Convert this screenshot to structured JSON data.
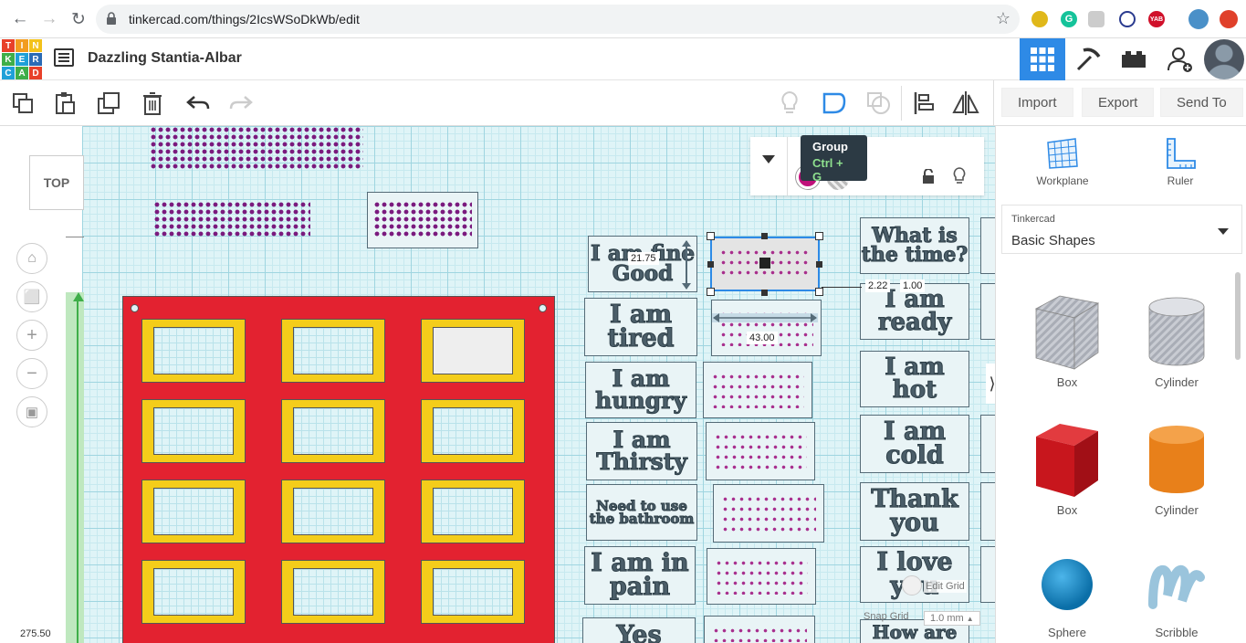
{
  "browser": {
    "url": "tinkercad.com/things/2IcsWSoDkWb/edit",
    "ext_yab": "YAB"
  },
  "app": {
    "logo_letters": [
      "T",
      "I",
      "N",
      "K",
      "E",
      "R",
      "C",
      "A",
      "D"
    ],
    "design_title": "Dazzling Stantia-Albar"
  },
  "toolbar": {
    "import_label": "Import",
    "export_label": "Export",
    "send_to_label": "Send To"
  },
  "tooltip": {
    "title": "Group",
    "shortcut": "Ctrl + G"
  },
  "viewcube": {
    "label": "TOP"
  },
  "workspace": {
    "dimensions": {
      "height": "21.75",
      "width": "43.00",
      "elevation": "2.22",
      "depth": "1.00"
    },
    "coord_readout": "275.50",
    "edit_grid_label": "Edit Grid",
    "snap_grid_label": "Snap Grid",
    "snap_grid_value": "1.0 mm",
    "cards_left": [
      {
        "text": "I am fine Good"
      },
      {
        "text": "I am tired"
      },
      {
        "text": "I am hungry"
      },
      {
        "text": "I am Thirsty"
      },
      {
        "text": "Need to use the bathroom"
      },
      {
        "text": "I am in pain"
      },
      {
        "text": "Yes"
      }
    ],
    "cards_right": [
      {
        "text": "What is the time?"
      },
      {
        "text": "I am ready"
      },
      {
        "text": "I am hot"
      },
      {
        "text": "I am cold"
      },
      {
        "text": "Thank you"
      },
      {
        "text": "I love you"
      },
      {
        "text": "How are"
      }
    ]
  },
  "right_panel": {
    "workplane_label": "Workplane",
    "ruler_label": "Ruler",
    "library_source": "Tinkercad",
    "library_name": "Basic Shapes",
    "shapes": [
      {
        "name": "Box",
        "color": "#b8bcc4"
      },
      {
        "name": "Cylinder",
        "color": "#b8bcc4"
      },
      {
        "name": "Box",
        "color": "#d4202a"
      },
      {
        "name": "Cylinder",
        "color": "#e8801a"
      },
      {
        "name": "Sphere",
        "color": "#1a8fd0"
      },
      {
        "name": "Scribble",
        "color": "#9ac4dc"
      }
    ]
  },
  "colors": {
    "board_red": "#e32230",
    "slot_yellow": "#f4cd1a",
    "braille_purple": "#7a1a7e",
    "selected_fill": "#c0117a",
    "header_active": "#2e8ae6"
  }
}
